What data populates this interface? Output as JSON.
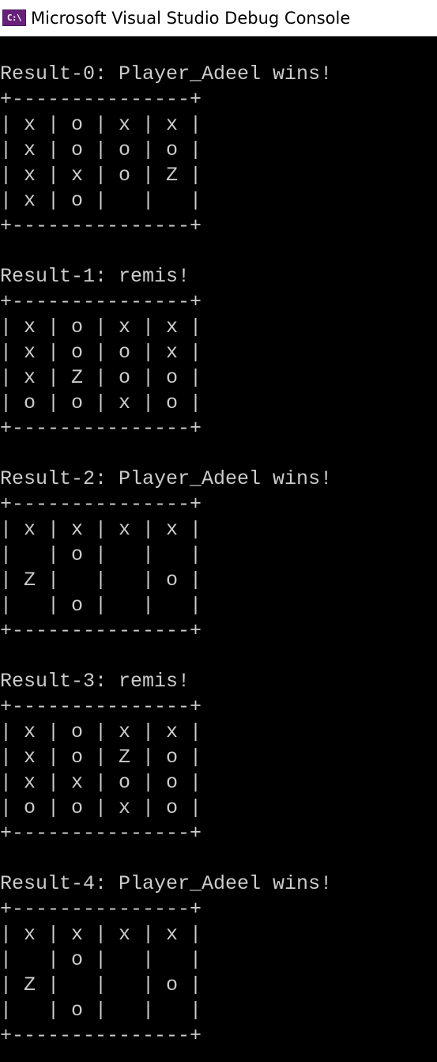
{
  "window": {
    "title": "Microsoft Visual Studio Debug Console",
    "icon": "vs-console-icon",
    "icon_text": "C:\\"
  },
  "console": {
    "text_color": "#cccccc",
    "background": "#000000",
    "lines": [
      "Result-0: Player_Adeel wins!",
      "+---------------+",
      "| x | o | x | x |",
      "| x | o | o | o |",
      "| x | x | o | Z |",
      "| x | o |   |   |",
      "+---------------+",
      "",
      "Result-1: remis!",
      "+---------------+",
      "| x | o | x | x |",
      "| x | o | o | x |",
      "| x | Z | o | o |",
      "| o | o | x | o |",
      "+---------------+",
      "",
      "Result-2: Player_Adeel wins!",
      "+---------------+",
      "| x | x | x | x |",
      "|   | o |   |   |",
      "| Z |   |   | o |",
      "|   | o |   |   |",
      "+---------------+",
      "",
      "Result-3: remis!",
      "+---------------+",
      "| x | o | x | x |",
      "| x | o | Z | o |",
      "| x | x | o | o |",
      "| o | o | x | o |",
      "+---------------+",
      "",
      "Result-4: Player_Adeel wins!",
      "+---------------+",
      "| x | x | x | x |",
      "|   | o |   |   |",
      "| Z |   |   | o |",
      "|   | o |   |   |",
      "+---------------+"
    ]
  }
}
